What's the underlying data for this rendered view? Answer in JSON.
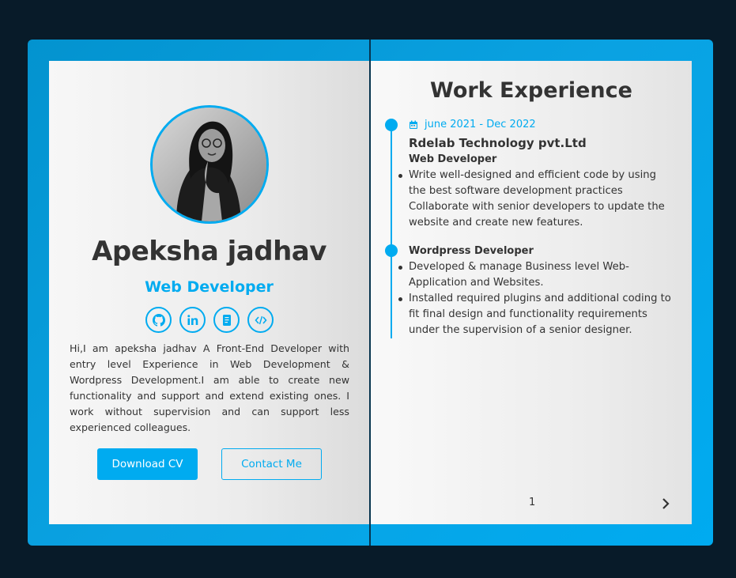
{
  "profile": {
    "name": "Apeksha jadhav",
    "role": "Web Developer",
    "about": "Hi,I am apeksha jadhav A Front-End Developer with entry level Experience in Web Development & Wordpress Development.I am able to create new functionality and support and extend existing ones. I work without supervision and can support less experienced colleagues.",
    "download_label": "Download CV",
    "contact_label": "Contact Me",
    "socials": [
      {
        "icon": "github-icon"
      },
      {
        "icon": "linkedin-icon"
      },
      {
        "icon": "resume-icon"
      },
      {
        "icon": "code-icon"
      }
    ]
  },
  "experience": {
    "title": "Work Experience",
    "date": "june 2021 - Dec 2022",
    "company": "Rdelab Technology pvt.Ltd",
    "jobs": [
      {
        "title": "Web Developer",
        "lines": [
          "Write well-designed and efficient code by using the best software development practices",
          "Collaborate with senior developers to update the website and create new features."
        ]
      },
      {
        "title": "Wordpress Developer",
        "lines": [
          "Developed & manage Business level Web-Application and Websites.",
          "Installed required plugins and additional coding to fit final design and functionality requirements under the supervision of a senior designer."
        ]
      }
    ]
  },
  "pagination": {
    "page": "1"
  },
  "colors": {
    "accent": "#00abf0",
    "background": "#081b29",
    "text": "#333333"
  }
}
